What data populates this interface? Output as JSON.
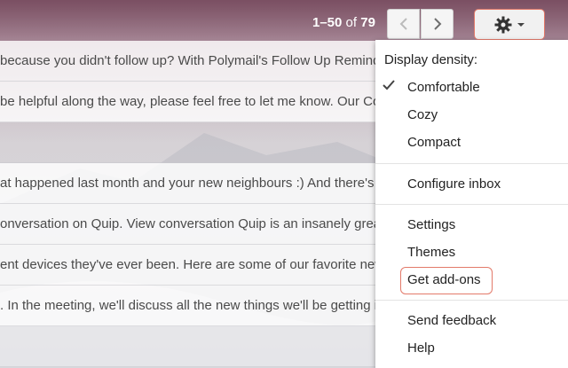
{
  "pagination": {
    "range": "1–50",
    "of": "of",
    "total": "79"
  },
  "icons": {
    "prev": "chevron-left-icon",
    "next": "chevron-right-icon",
    "settings": "gear-icon",
    "check": "checkmark-icon"
  },
  "emails": [
    "because you didn't follow up? With Polymail's Follow Up Reminde",
    "be helpful along the way, please feel free to let me know. Our Co",
    "",
    "at happened last month and your new neighbours :) And there's m",
    "onversation on Quip. View conversation Quip is an insanely grea",
    "ent devices they've ever been. Here are some of our favorite new",
    ". In the meeting, we'll discuss all the new things we'll be getting i",
    ""
  ],
  "menu": {
    "header": "Display density:",
    "density": [
      "Comfortable",
      "Cozy",
      "Compact"
    ],
    "selected_density": "Comfortable",
    "configure": "Configure inbox",
    "settings": "Settings",
    "themes": "Themes",
    "addons": "Get add-ons",
    "feedback": "Send feedback",
    "help": "Help"
  },
  "colors": {
    "highlight_ring": "#e37a6a"
  }
}
